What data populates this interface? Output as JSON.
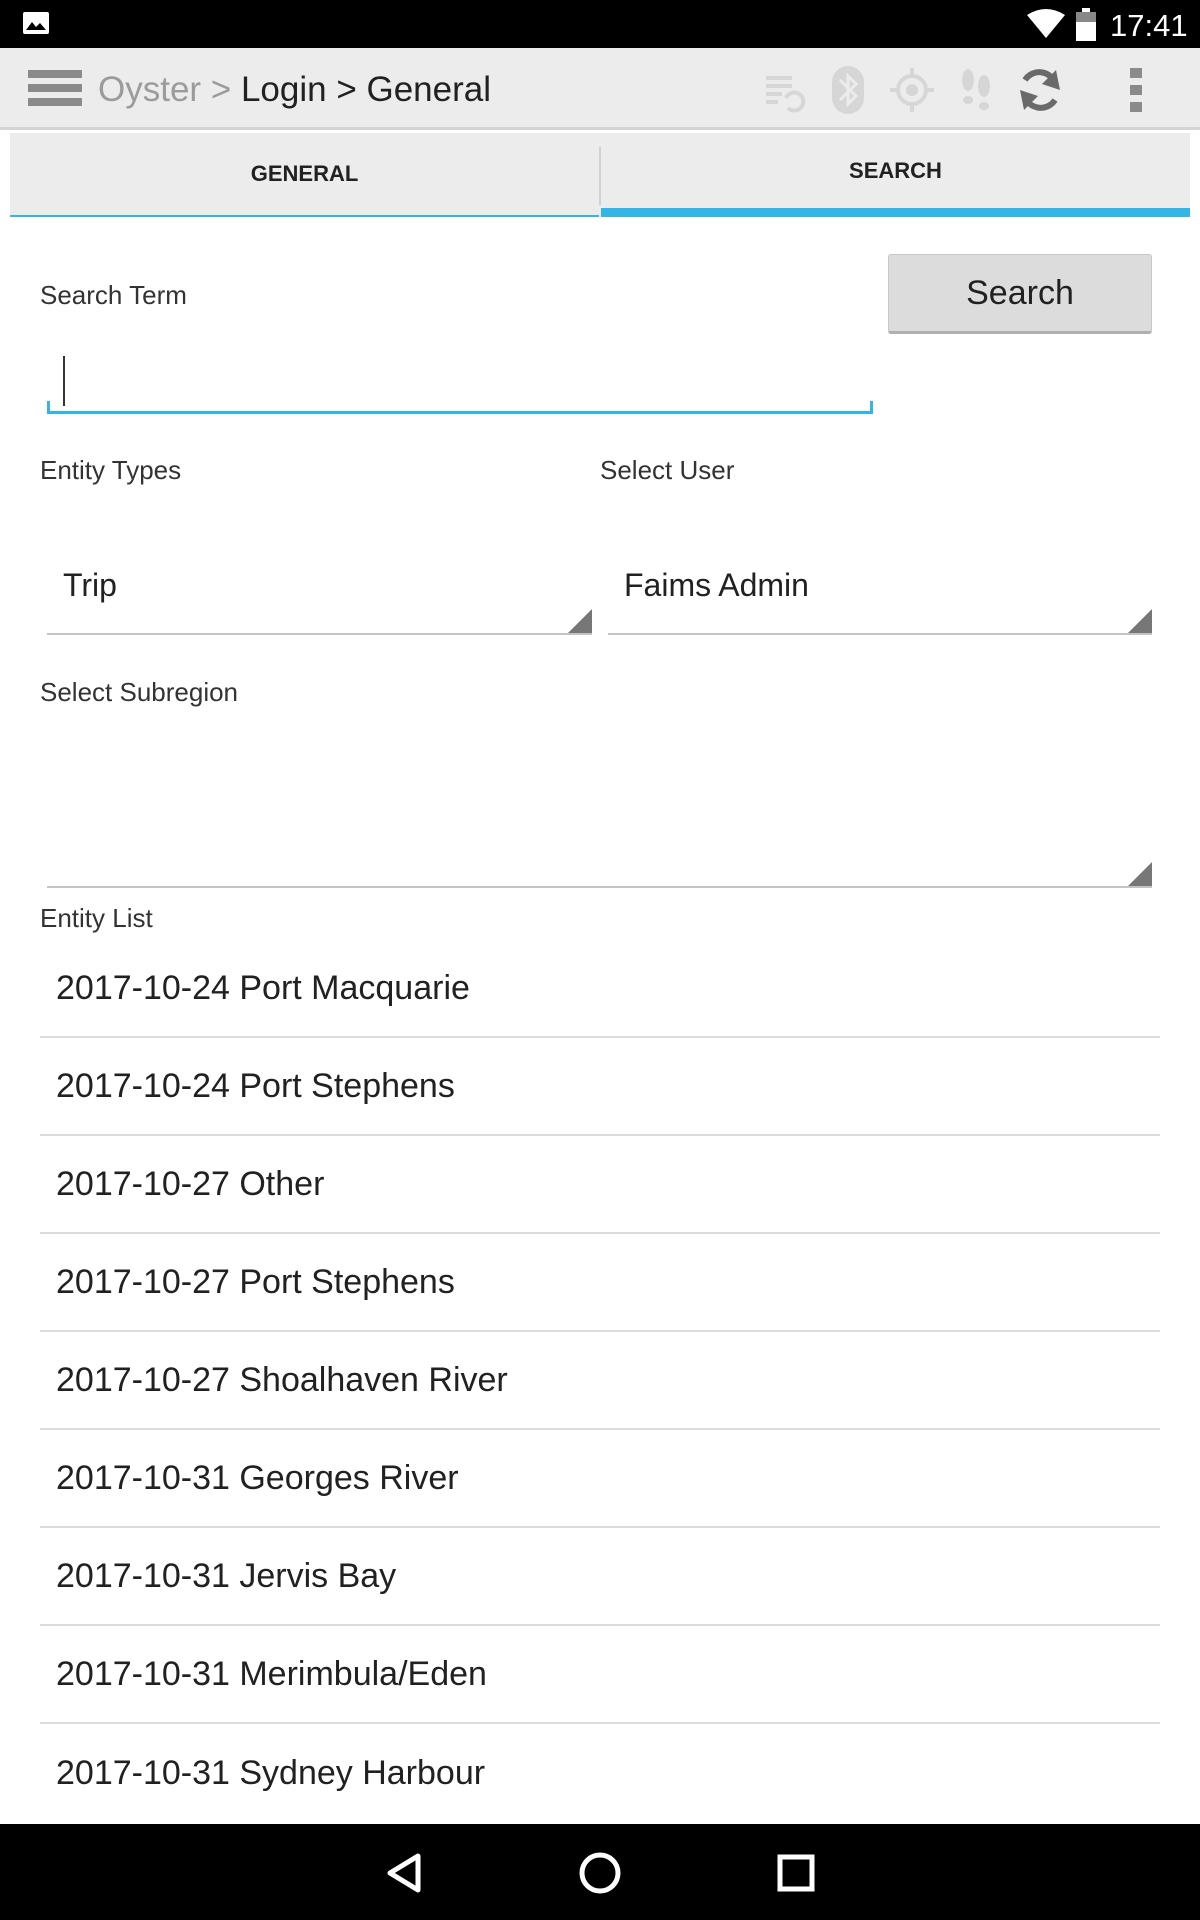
{
  "status_bar": {
    "time": "17:41",
    "icons": [
      "image-icon",
      "wifi-icon",
      "battery-icon"
    ]
  },
  "action_bar": {
    "breadcrumb_root": "Oyster >",
    "breadcrumb_rest": "Login > General",
    "icons": [
      "menu-icon",
      "sync-status-icon",
      "bluetooth-icon",
      "gps-icon",
      "tracking-icon",
      "refresh-icon",
      "overflow-menu-icon"
    ]
  },
  "tabs": [
    {
      "label": "GENERAL",
      "selected": false
    },
    {
      "label": "SEARCH",
      "selected": true
    }
  ],
  "form": {
    "search_term_label": "Search Term",
    "search_term_value": "",
    "search_button_label": "Search",
    "entity_types_label": "Entity Types",
    "entity_types_value": "Trip",
    "select_user_label": "Select User",
    "select_user_value": "Faims Admin",
    "select_subregion_label": "Select Subregion",
    "select_subregion_value": ""
  },
  "entity_list": {
    "label": "Entity List",
    "items": [
      "2017-10-24 Port Macquarie",
      "2017-10-24 Port Stephens",
      "2017-10-27 Other",
      "2017-10-27 Port Stephens",
      "2017-10-27 Shoalhaven River",
      "2017-10-31 Georges River",
      "2017-10-31 Jervis Bay",
      "2017-10-31 Merimbula/Eden",
      "2017-10-31 Sydney Harbour"
    ]
  },
  "nav_bar": {
    "icons": [
      "back-icon",
      "home-icon",
      "recents-icon"
    ]
  },
  "colors": {
    "accent": "#33b5e5",
    "action_bar_bg": "#ececec",
    "system_bar_bg": "#000000"
  }
}
